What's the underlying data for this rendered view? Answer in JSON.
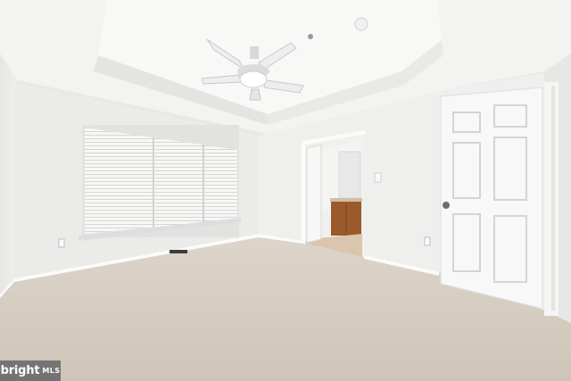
{
  "photo": {
    "subject": "empty-bedroom-interior"
  },
  "watermark": {
    "brand": "bright",
    "suffix": "MLS"
  },
  "colors": {
    "wall": "#efefee",
    "ceiling": "#f4f4f3",
    "carpet": "#d8cfc4",
    "door": "#f8f8f8",
    "vanity": "#9a5a2a",
    "window_light": "#f6f6f4"
  }
}
